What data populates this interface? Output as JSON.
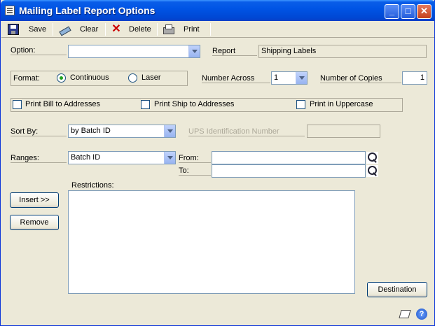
{
  "window": {
    "title": "Mailing Label Report Options",
    "controls": {
      "minimize": "_",
      "maximize": "□",
      "close": "✕"
    }
  },
  "toolbar": {
    "save": "Save",
    "clear": "Clear",
    "delete": "Delete",
    "print": "Print"
  },
  "option": {
    "label": "Option:",
    "value": ""
  },
  "report": {
    "label": "Report",
    "value": "Shipping Labels"
  },
  "format": {
    "label": "Format:",
    "continuous": "Continuous",
    "laser": "Laser",
    "selected": "Continuous"
  },
  "number_across": {
    "label": "Number Across",
    "value": "1"
  },
  "number_of_copies": {
    "label": "Number of Copies",
    "value": "1"
  },
  "checkboxes": {
    "bill_to": {
      "label": "Print Bill to Addresses",
      "checked": false
    },
    "ship_to": {
      "label": "Print Ship to Addresses",
      "checked": false
    },
    "uppercase": {
      "label": "Print in Uppercase",
      "checked": false
    }
  },
  "sort_by": {
    "label": "Sort By:",
    "value": "by Batch ID"
  },
  "ups": {
    "label": "UPS Identification Number",
    "value": ""
  },
  "ranges": {
    "label": "Ranges:",
    "value": "Batch ID"
  },
  "from": {
    "label": "From:",
    "value": ""
  },
  "to": {
    "label": "To:",
    "value": ""
  },
  "restrictions": {
    "label": "Restrictions:"
  },
  "buttons": {
    "insert": "Insert >>",
    "remove": "Remove",
    "destination": "Destination"
  }
}
